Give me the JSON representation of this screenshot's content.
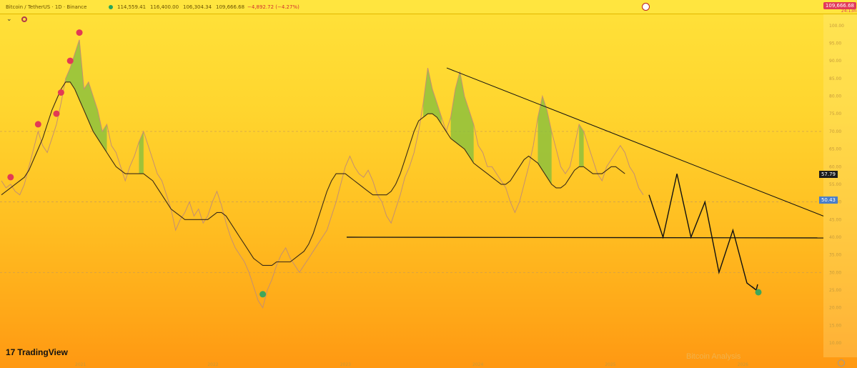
{
  "header": {
    "symbol": "Bitcoin / TetherUS · 1D · Binance",
    "open": "114,559.41",
    "high": "116,400.00",
    "low": "106,304.34",
    "close": "109,666.68",
    "change": "−4,892.72 (−4.27%)",
    "price_badge": "109,666.68",
    "sub_badge": "24:13h"
  },
  "brand": "TradingView",
  "watermark": "Bitcoin Analysis",
  "tags": {
    "rsi_value": "57.79",
    "rsi_ma_value": "50.43"
  },
  "chart_data": {
    "type": "line",
    "y_ticks": [
      "100.00",
      "95.00",
      "90.00",
      "85.00",
      "80.00",
      "75.00",
      "70.00",
      "65.00",
      "60.00",
      "55.00",
      "50.00",
      "45.00",
      "40.00",
      "35.00",
      "30.00",
      "25.00",
      "20.00",
      "15.00",
      "10.00"
    ],
    "ylim": [
      10,
      102
    ],
    "x_ticks": [
      "",
      "2021",
      "",
      "2022",
      "",
      "2023",
      "",
      "2024",
      "",
      "2025",
      "",
      "2026",
      ""
    ],
    "reference_lines": [
      70,
      50,
      30
    ],
    "series": [
      {
        "values": [
          56,
          54,
          55,
          53,
          52,
          55,
          60,
          65,
          70,
          66,
          64,
          68,
          72,
          78,
          85,
          88,
          92,
          96,
          82,
          84,
          80,
          76,
          70,
          72,
          66,
          64,
          60,
          56,
          60,
          63,
          67,
          70,
          66,
          62,
          58,
          56,
          52,
          48,
          42,
          45,
          47,
          50,
          46,
          48,
          44,
          46,
          50,
          53,
          49,
          44,
          40,
          37,
          35,
          33,
          30,
          26,
          22,
          20,
          25,
          28,
          32,
          35,
          37,
          34,
          32,
          30,
          32,
          34,
          36,
          38,
          40,
          42,
          46,
          50,
          55,
          60,
          63,
          60,
          58,
          57,
          59,
          56,
          52,
          50,
          46,
          44,
          48,
          52,
          57,
          60,
          64,
          70,
          78,
          88,
          82,
          78,
          74,
          70,
          74,
          82,
          87,
          80,
          76,
          72,
          66,
          64,
          60,
          60,
          58,
          56,
          54,
          50,
          47,
          50,
          55,
          60,
          66,
          74,
          80,
          76,
          70,
          65,
          60,
          58,
          60,
          66,
          72,
          70,
          66,
          62,
          58,
          56,
          60,
          62,
          64,
          66,
          64,
          60,
          58,
          54,
          52
        ]
      },
      {
        "values": [
          52,
          53,
          54,
          55,
          56,
          57,
          59,
          62,
          65,
          68,
          72,
          76,
          79,
          82,
          84,
          84,
          82,
          79,
          76,
          73,
          70,
          68,
          66,
          64,
          62,
          60,
          59,
          58,
          58,
          58,
          58,
          58,
          57,
          56,
          54,
          52,
          50,
          48,
          47,
          46,
          45,
          45,
          45,
          45,
          45,
          45,
          46,
          47,
          47,
          46,
          44,
          42,
          40,
          38,
          36,
          34,
          33,
          32,
          32,
          32,
          33,
          33,
          33,
          33,
          34,
          35,
          36,
          38,
          41,
          45,
          49,
          53,
          56,
          58,
          58,
          58,
          57,
          56,
          55,
          54,
          53,
          52,
          52,
          52,
          52,
          53,
          55,
          58,
          62,
          66,
          70,
          73,
          74,
          75,
          75,
          74,
          72,
          70,
          68,
          67,
          66,
          65,
          63,
          61,
          60,
          59,
          58,
          57,
          56,
          55,
          55,
          56,
          58,
          60,
          62,
          63,
          62,
          61,
          59,
          57,
          55,
          54,
          54,
          55,
          57,
          59,
          60,
          60,
          59,
          58,
          58,
          58,
          59,
          60,
          60,
          59,
          58
        ]
      }
    ],
    "peaks": [
      96,
      70,
      55,
      88,
      79,
      73
    ],
    "troughs": [
      22
    ],
    "projection": [
      52,
      40,
      58,
      40,
      50,
      30,
      42,
      27
    ],
    "target": 25,
    "trendline": [
      88,
      46
    ],
    "support": 40
  },
  "colors": {
    "rsi": "#c59070",
    "rsi_ma": "#3a2a15",
    "peak_dot": "#e23a55",
    "trough_dot": "#3fa65a",
    "overbought_fill": "#7fbf3f",
    "line": "#111111"
  }
}
